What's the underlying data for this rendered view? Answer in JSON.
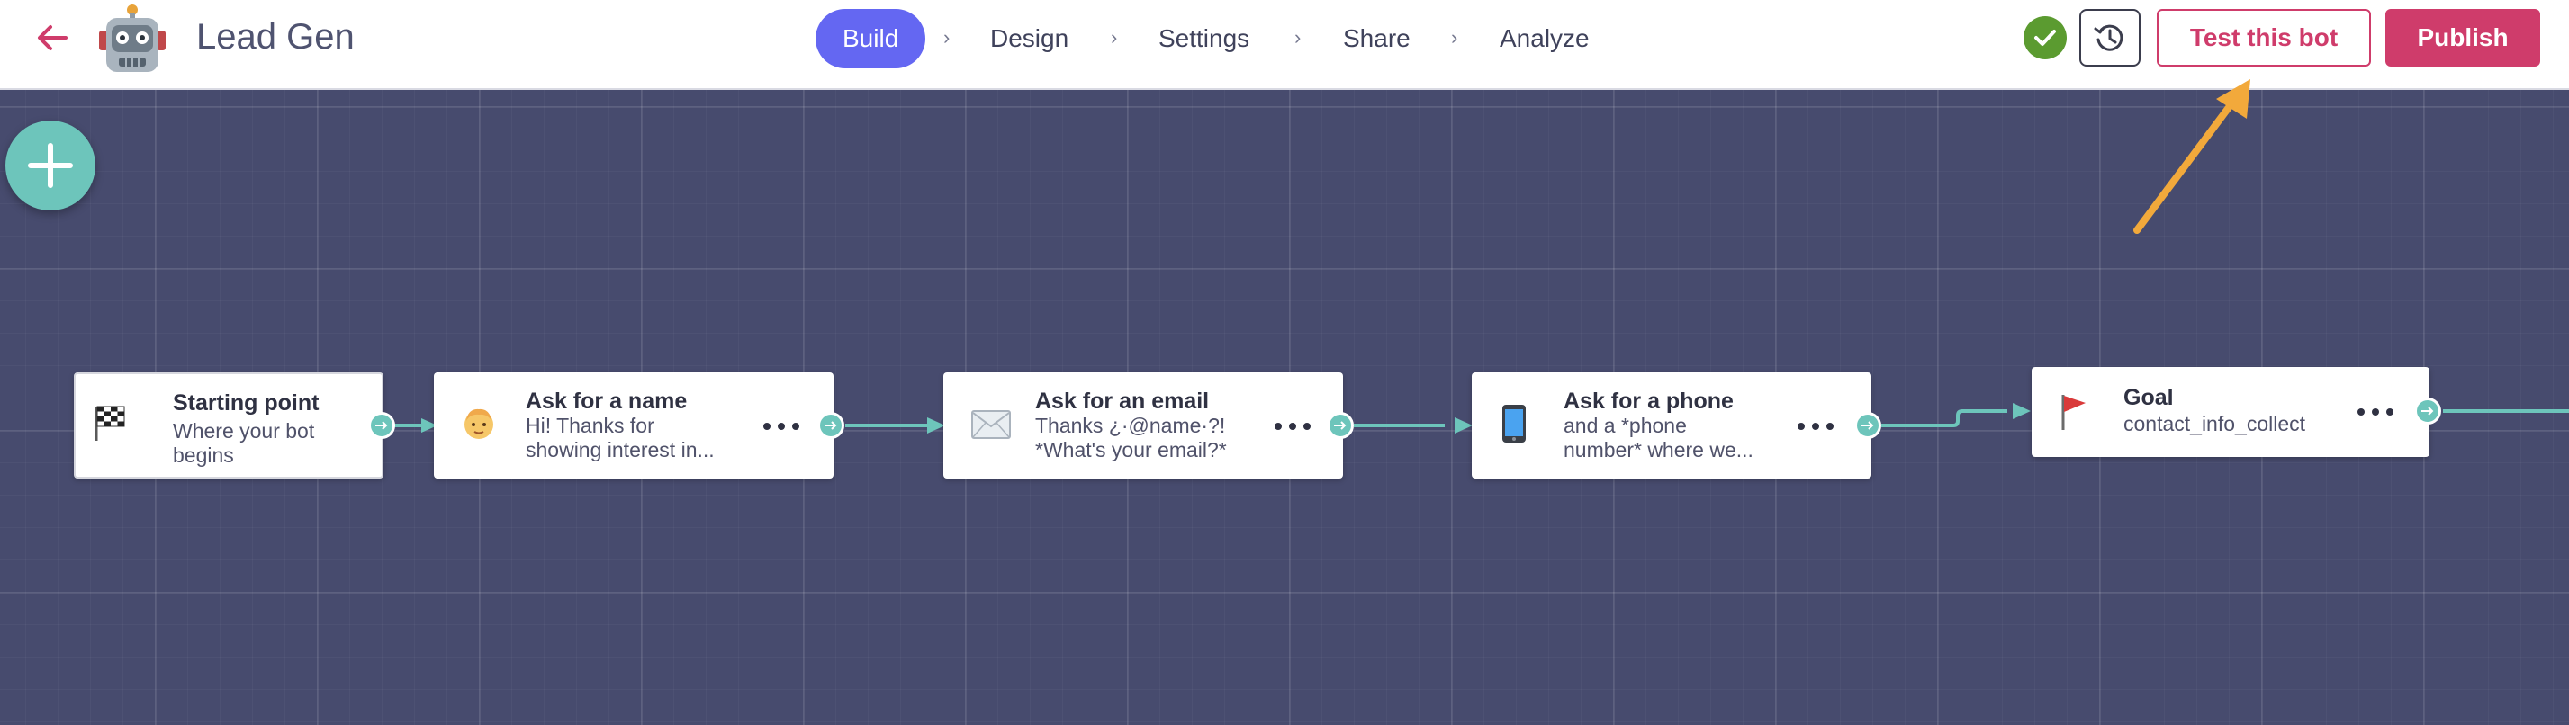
{
  "header": {
    "title": "Lead Gen",
    "back_icon": "arrow-left-icon",
    "logo_icon": "robot-icon",
    "nav": [
      {
        "label": "Build",
        "active": true
      },
      {
        "label": "Design",
        "active": false
      },
      {
        "label": "Settings",
        "active": false
      },
      {
        "label": "Share",
        "active": false
      },
      {
        "label": "Analyze",
        "active": false
      }
    ],
    "status_icon": "check-icon",
    "history_icon": "history-icon",
    "test_label": "Test this bot",
    "publish_label": "Publish"
  },
  "canvas": {
    "add_icon": "plus-icon",
    "nodes": [
      {
        "title": "Starting point",
        "text": "Where your bot\nbegins",
        "icon": "checkered-flag-icon"
      },
      {
        "title": "Ask for a name",
        "text": "Hi! Thanks for\nshowing interest in...",
        "icon": "person-face-icon"
      },
      {
        "title": "Ask for an email",
        "text": "Thanks ¿·@name·?!\n*What's your email?*",
        "icon": "envelope-icon"
      },
      {
        "title": "Ask for a phone",
        "text": "and a *phone\nnumber* where we...",
        "icon": "mobile-phone-icon"
      },
      {
        "title": "Goal",
        "text": "contact_info_collect",
        "icon": "red-flag-icon"
      }
    ]
  },
  "colors": {
    "accent": "#6467f2",
    "brand": "#cf3c6b",
    "canvas": "#474b6e",
    "connector": "#6dc5bb",
    "success": "#5b9b30",
    "annotation_arrow": "#f2a93b"
  }
}
